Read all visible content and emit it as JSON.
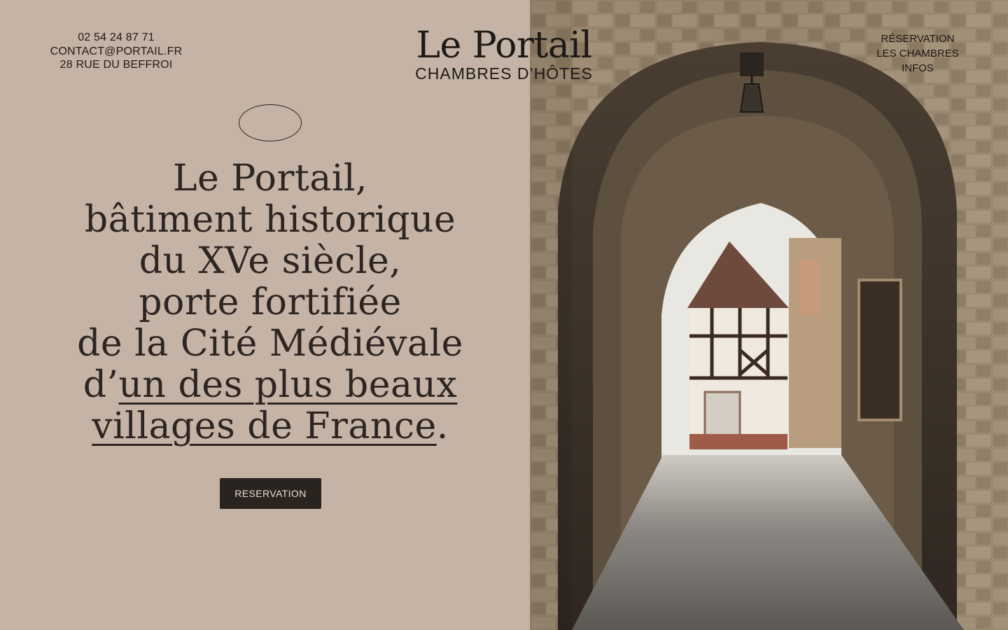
{
  "contact": {
    "phone": "02 54 24 87 71",
    "email": "CONTACT@PORTAIL.FR",
    "address": "28 RUE DU BEFFROI"
  },
  "brand": {
    "name": "Le Portail",
    "subtitle": "CHAMBRES D’HÔTES"
  },
  "nav": {
    "items": [
      "RÉSERVATION",
      "LES CHAMBRES",
      "INFOS"
    ]
  },
  "hero": {
    "lines": [
      "Le Portail,",
      "bâtiment historique",
      "du XVe siècle,",
      "porte fortifiée",
      "de la Cité Médiévale"
    ],
    "line6_prefix": "d’",
    "link_part1": "un des plus beaux",
    "link_part2": "villages de France",
    "suffix": ".",
    "cta_label": "RESERVATION"
  },
  "colors": {
    "background": "#c5b4a5",
    "text": "#2a2320",
    "button": "#2a2420"
  }
}
